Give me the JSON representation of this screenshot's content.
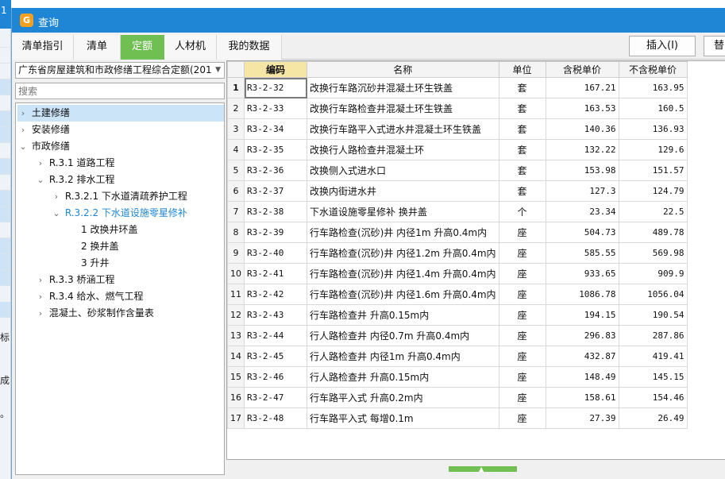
{
  "background": {
    "top_number": "1",
    "side_text_1": "标",
    "side_text_2": "成",
    "side_text_3": "。"
  },
  "window": {
    "title": "查询",
    "logo_glyph": "G"
  },
  "tabs": [
    {
      "label": "清单指引",
      "active": false
    },
    {
      "label": "清单",
      "active": false
    },
    {
      "label": "定额",
      "active": true
    },
    {
      "label": "人材机",
      "active": false
    },
    {
      "label": "我的数据",
      "active": false
    }
  ],
  "buttons": {
    "insert": "插入(I)",
    "replace_partial": "替"
  },
  "left_panel": {
    "library_select": "广东省房屋建筑和市政修缮工程综合定额(201",
    "search_placeholder": "搜索",
    "tree": [
      {
        "label": "土建修缮",
        "expander": "›",
        "selected": true
      },
      {
        "label": "安装修缮",
        "expander": "›"
      },
      {
        "label": "市政修缮",
        "expander": "⌄"
      },
      {
        "label": "R.3.1 道路工程",
        "expander": "›"
      },
      {
        "label": "R.3.2 排水工程",
        "expander": "⌄"
      },
      {
        "label": "R.3.2.1 下水道清疏养护工程",
        "expander": "›"
      },
      {
        "label": "R.3.2.2 下水道设施零星修补",
        "expander": "⌄",
        "highlight": true
      },
      {
        "label": "1 改换井环盖",
        "expander": ""
      },
      {
        "label": "2 换井盖",
        "expander": ""
      },
      {
        "label": "3 升井",
        "expander": ""
      },
      {
        "label": "R.3.3 桥涵工程",
        "expander": "›"
      },
      {
        "label": "R.3.4 给水、燃气工程",
        "expander": "›"
      },
      {
        "label": "混凝土、砂浆制作含量表",
        "expander": "›"
      }
    ]
  },
  "grid": {
    "headers": [
      "编码",
      "名称",
      "单位",
      "含税单价",
      "不含税单价"
    ],
    "rows": [
      {
        "n": "1",
        "code": "R3-2-32",
        "name": "改换行车路沉砂井混凝土环生铁盖",
        "unit": "套",
        "tax": "167.21",
        "notax": "163.95"
      },
      {
        "n": "2",
        "code": "R3-2-33",
        "name": "改换行车路检查井混凝土环生铁盖",
        "unit": "套",
        "tax": "163.53",
        "notax": "160.5"
      },
      {
        "n": "3",
        "code": "R3-2-34",
        "name": "改换行车路平入式进水井混凝土环生铁盖",
        "unit": "套",
        "tax": "140.36",
        "notax": "136.93"
      },
      {
        "n": "4",
        "code": "R3-2-35",
        "name": "改换行人路检查井混凝土环",
        "unit": "套",
        "tax": "132.22",
        "notax": "129.6"
      },
      {
        "n": "5",
        "code": "R3-2-36",
        "name": "改换侧入式进水口",
        "unit": "套",
        "tax": "153.98",
        "notax": "151.57"
      },
      {
        "n": "6",
        "code": "R3-2-37",
        "name": "改换内街进水井",
        "unit": "套",
        "tax": "127.3",
        "notax": "124.79"
      },
      {
        "n": "7",
        "code": "R3-2-38",
        "name": "下水道设施零星修补 换井盖",
        "unit": "个",
        "tax": "23.34",
        "notax": "22.5"
      },
      {
        "n": "8",
        "code": "R3-2-39",
        "name": "行车路检查(沉砂)井 内径1m 升高0.4m内",
        "unit": "座",
        "tax": "504.73",
        "notax": "489.78"
      },
      {
        "n": "9",
        "code": "R3-2-40",
        "name": "行车路检查(沉砂)井 内径1.2m 升高0.4m内",
        "unit": "座",
        "tax": "585.55",
        "notax": "569.98"
      },
      {
        "n": "10",
        "code": "R3-2-41",
        "name": "行车路检查(沉砂)井 内径1.4m 升高0.4m内",
        "unit": "座",
        "tax": "933.65",
        "notax": "909.9"
      },
      {
        "n": "11",
        "code": "R3-2-42",
        "name": "行车路检查(沉砂)井 内径1.6m 升高0.4m内",
        "unit": "座",
        "tax": "1086.78",
        "notax": "1056.04"
      },
      {
        "n": "12",
        "code": "R3-2-43",
        "name": "行车路检查井 升高0.15m内",
        "unit": "座",
        "tax": "194.15",
        "notax": "190.54"
      },
      {
        "n": "13",
        "code": "R3-2-44",
        "name": "行人路检查井 内径0.7m 升高0.4m内",
        "unit": "座",
        "tax": "296.83",
        "notax": "287.86"
      },
      {
        "n": "14",
        "code": "R3-2-45",
        "name": "行人路检查井 内径1m 升高0.4m内",
        "unit": "座",
        "tax": "432.87",
        "notax": "419.41"
      },
      {
        "n": "15",
        "code": "R3-2-46",
        "name": "行人路检查井 升高0.15m内",
        "unit": "座",
        "tax": "148.49",
        "notax": "145.15"
      },
      {
        "n": "16",
        "code": "R3-2-47",
        "name": "行车路平入式 升高0.2m内",
        "unit": "座",
        "tax": "158.61",
        "notax": "154.46"
      },
      {
        "n": "17",
        "code": "R3-2-48",
        "name": "行车路平入式 每增0.1m",
        "unit": "座",
        "tax": "27.39",
        "notax": "26.49"
      }
    ]
  },
  "colors": {
    "titlebar": "#1f86d6",
    "active_tab": "#6fbf53",
    "header_highlight": "#f6e6a5"
  }
}
